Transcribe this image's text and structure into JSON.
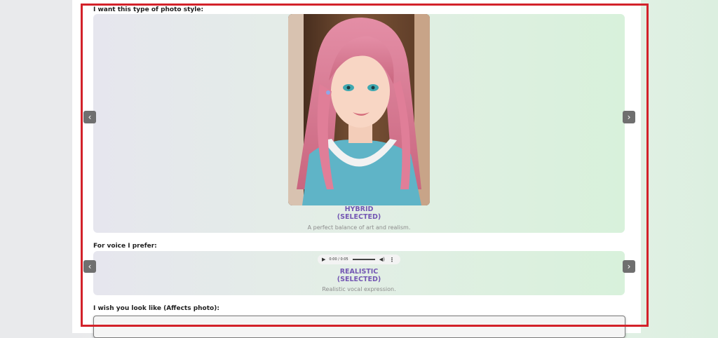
{
  "photo_style": {
    "label": "I want this type of photo style:",
    "title_line1": "HYBRID",
    "title_line2": "(SELECTED)",
    "description": "A perfect balance of art and realism."
  },
  "voice": {
    "label": "For voice I prefer:",
    "player_time": "0:00 / 0:05",
    "title_line1": "REALISTIC",
    "title_line2": "(SELECTED)",
    "description": "Realistic vocal expression."
  },
  "appearance": {
    "label": "I wish you look like (Affects photo):"
  },
  "icons": {
    "prev": "chevron-left-icon",
    "next": "chevron-right-icon",
    "play": "play-icon",
    "volume": "volume-icon",
    "more": "more-vert-icon"
  },
  "colors": {
    "accent": "#7356b3",
    "highlight_border": "#d3222a",
    "nav_button": "#6f6f6f"
  }
}
